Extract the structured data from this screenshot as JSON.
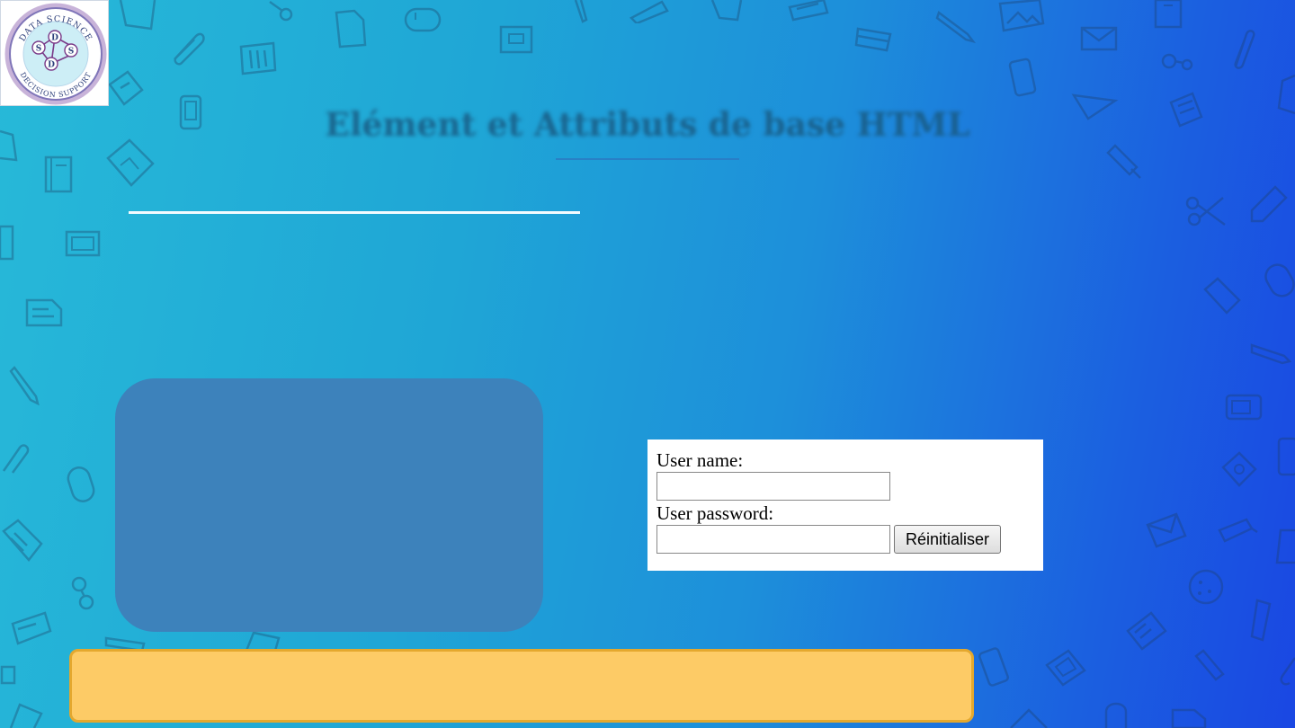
{
  "slide": {
    "title": "Elément et Attributs de base HTML"
  },
  "logo": {
    "name": "logo-sdds",
    "ring_top_text": "DATA SCIENCE",
    "ring_bottom_text": "DECISION SUPPORT",
    "letters": [
      "S",
      "D",
      "D",
      "S"
    ]
  },
  "login_form": {
    "username_label": "User name:",
    "username_value": "",
    "password_label": "User password:",
    "password_value": "",
    "reset_label": "Réinitialiser"
  },
  "colors": {
    "background_start": "#27b9d8",
    "background_end": "#1a47e3",
    "panel": "#3d82bb",
    "yellow_bar": "#fdcb66",
    "yellow_bar_border": "#e4a82e"
  },
  "background_icons": [
    "pencil-icon",
    "document-icon",
    "paperclip-icon",
    "envelope-icon",
    "phone-icon",
    "scissors-icon",
    "ruler-icon",
    "notebook-icon",
    "image-icon",
    "mouse-icon",
    "credit-card-icon",
    "usb-icon",
    "marker-icon",
    "cookie-icon",
    "tablet-icon",
    "glasses-icon"
  ]
}
